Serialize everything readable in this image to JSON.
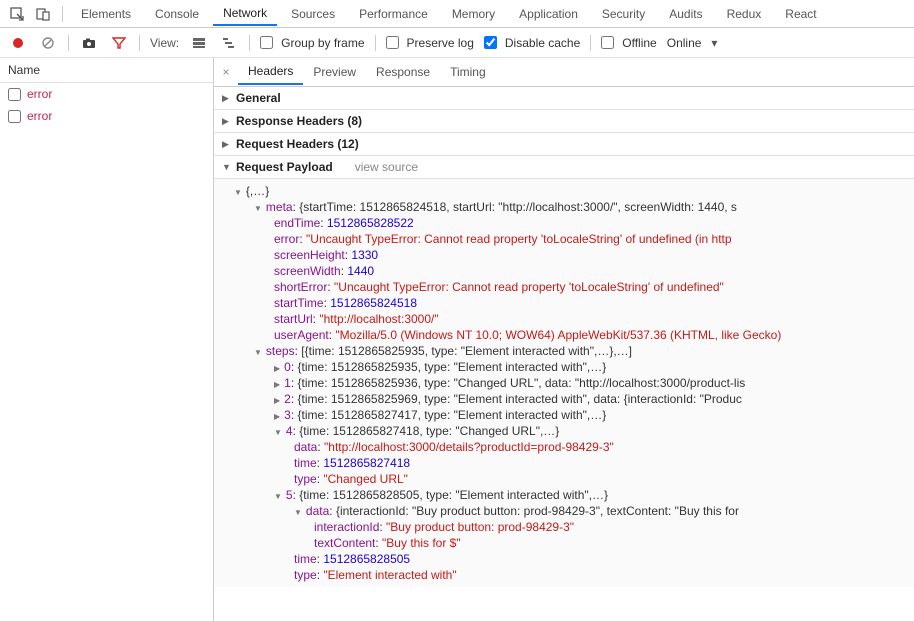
{
  "panel_tabs": [
    "Elements",
    "Console",
    "Network",
    "Sources",
    "Performance",
    "Memory",
    "Application",
    "Security",
    "Audits",
    "Redux",
    "React"
  ],
  "panel_active": "Network",
  "toolbar": {
    "view_label": "View:",
    "group_by_frame": "Group by frame",
    "preserve_log": "Preserve log",
    "disable_cache": "Disable cache",
    "offline": "Offline",
    "online_label": "Online"
  },
  "sidebar": {
    "header": "Name",
    "items": [
      {
        "name": "error"
      },
      {
        "name": "error"
      }
    ]
  },
  "detail_tabs": [
    "Headers",
    "Preview",
    "Response",
    "Timing"
  ],
  "detail_active": "Headers",
  "sections": {
    "general": "General",
    "response_headers": "Response Headers (8)",
    "request_headers": "Request Headers (12)",
    "request_payload": "Request Payload",
    "view_source": "view source"
  },
  "payload": {
    "root": "{,…}",
    "meta_inline": "{startTime: 1512865824518, startUrl: \"http://localhost:3000/\", screenWidth: 1440, s",
    "meta": {
      "endTime": "1512865828522",
      "error": "\"Uncaught TypeError: Cannot read property 'toLocaleString' of undefined (in http",
      "screenHeight": "1330",
      "screenWidth": "1440",
      "shortError": "\"Uncaught TypeError: Cannot read property 'toLocaleString' of undefined\"",
      "startTime": "1512865824518",
      "startUrl": "\"http://localhost:3000/\"",
      "userAgent": "\"Mozilla/5.0 (Windows NT 10.0; WOW64) AppleWebKit/537.36 (KHTML, like Gecko)"
    },
    "steps_inline": "[{time: 1512865825935, type: \"Element interacted with\",…},…]",
    "steps": [
      "{time: 1512865825935, type: \"Element interacted with\",…}",
      "{time: 1512865825936, type: \"Changed URL\", data: \"http://localhost:3000/product-lis",
      "{time: 1512865825969, type: \"Element interacted with\", data: {interactionId: \"Produc",
      "{time: 1512865827417, type: \"Element interacted with\",…}"
    ],
    "step4": {
      "inline": "{time: 1512865827418, type: \"Changed URL\",…}",
      "data": "\"http://localhost:3000/details?productId=prod-98429-3\"",
      "time": "1512865827418",
      "type": "\"Changed URL\""
    },
    "step5": {
      "inline": "{time: 1512865828505, type: \"Element interacted with\",…}",
      "data_inline": "{interactionId: \"Buy product button: prod-98429-3\", textContent: \"Buy this for ",
      "interactionId": "\"Buy product button: prod-98429-3\"",
      "textContent": "\"Buy this for $\"",
      "time": "1512865828505",
      "type": "\"Element interacted with\""
    }
  }
}
